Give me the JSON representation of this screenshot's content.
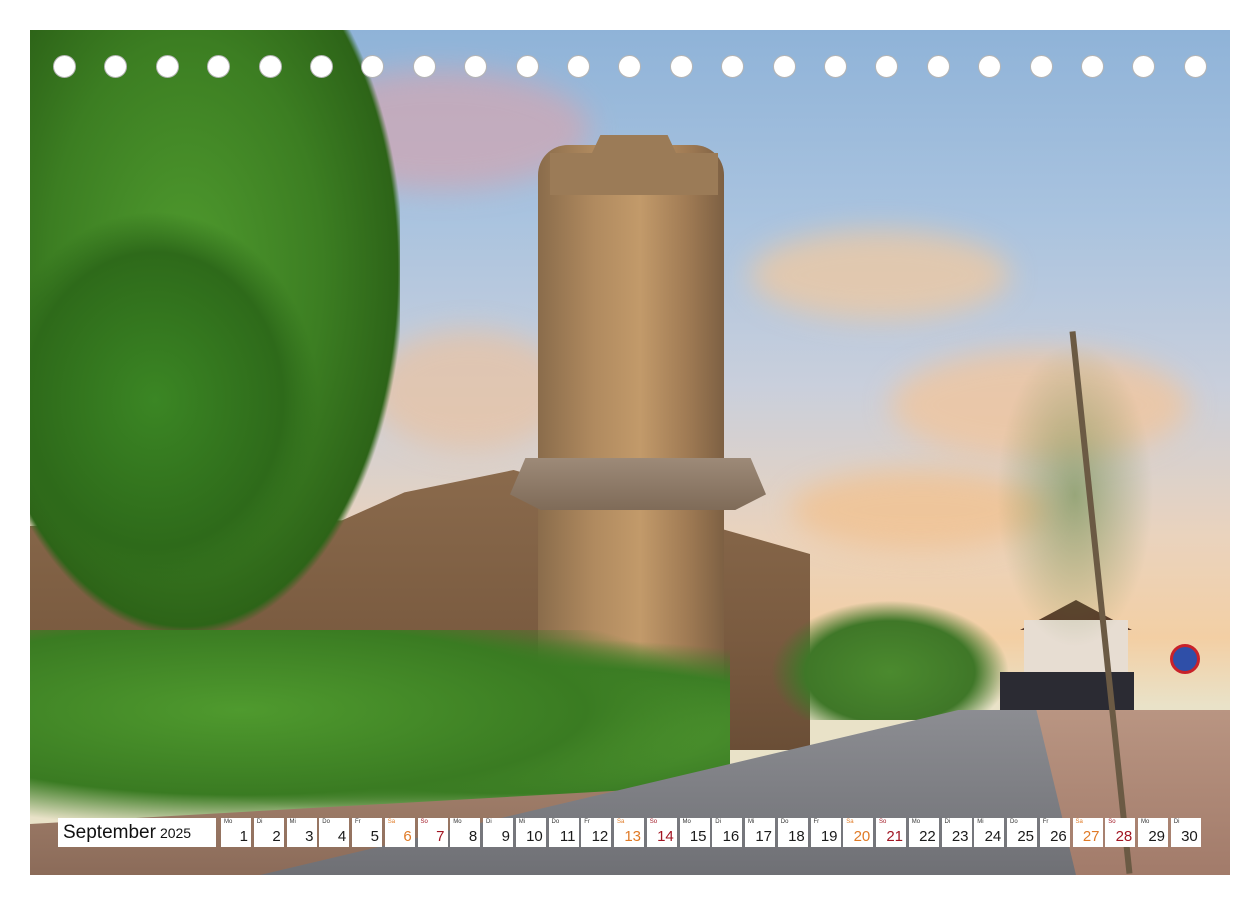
{
  "calendar": {
    "month": "September",
    "year": "2025",
    "days": [
      {
        "wd": "Mo",
        "num": "1",
        "type": "weekday"
      },
      {
        "wd": "Di",
        "num": "2",
        "type": "weekday"
      },
      {
        "wd": "Mi",
        "num": "3",
        "type": "weekday"
      },
      {
        "wd": "Do",
        "num": "4",
        "type": "weekday"
      },
      {
        "wd": "Fr",
        "num": "5",
        "type": "weekday"
      },
      {
        "wd": "Sa",
        "num": "6",
        "type": "sat"
      },
      {
        "wd": "So",
        "num": "7",
        "type": "sun"
      },
      {
        "wd": "Mo",
        "num": "8",
        "type": "weekday"
      },
      {
        "wd": "Di",
        "num": "9",
        "type": "weekday"
      },
      {
        "wd": "Mi",
        "num": "10",
        "type": "weekday"
      },
      {
        "wd": "Do",
        "num": "11",
        "type": "weekday"
      },
      {
        "wd": "Fr",
        "num": "12",
        "type": "weekday"
      },
      {
        "wd": "Sa",
        "num": "13",
        "type": "sat"
      },
      {
        "wd": "So",
        "num": "14",
        "type": "sun"
      },
      {
        "wd": "Mo",
        "num": "15",
        "type": "weekday"
      },
      {
        "wd": "Di",
        "num": "16",
        "type": "weekday"
      },
      {
        "wd": "Mi",
        "num": "17",
        "type": "weekday"
      },
      {
        "wd": "Do",
        "num": "18",
        "type": "weekday"
      },
      {
        "wd": "Fr",
        "num": "19",
        "type": "weekday"
      },
      {
        "wd": "Sa",
        "num": "20",
        "type": "sat"
      },
      {
        "wd": "So",
        "num": "21",
        "type": "sun"
      },
      {
        "wd": "Mo",
        "num": "22",
        "type": "weekday"
      },
      {
        "wd": "Di",
        "num": "23",
        "type": "weekday"
      },
      {
        "wd": "Mi",
        "num": "24",
        "type": "weekday"
      },
      {
        "wd": "Do",
        "num": "25",
        "type": "weekday"
      },
      {
        "wd": "Fr",
        "num": "26",
        "type": "weekday"
      },
      {
        "wd": "Sa",
        "num": "27",
        "type": "sat"
      },
      {
        "wd": "So",
        "num": "28",
        "type": "sun"
      },
      {
        "wd": "Mo",
        "num": "29",
        "type": "weekday"
      },
      {
        "wd": "Di",
        "num": "30",
        "type": "weekday"
      }
    ]
  },
  "colors": {
    "saturday": "#e07a26",
    "sunday": "#a11522",
    "weekday": "#1a1a1a"
  }
}
